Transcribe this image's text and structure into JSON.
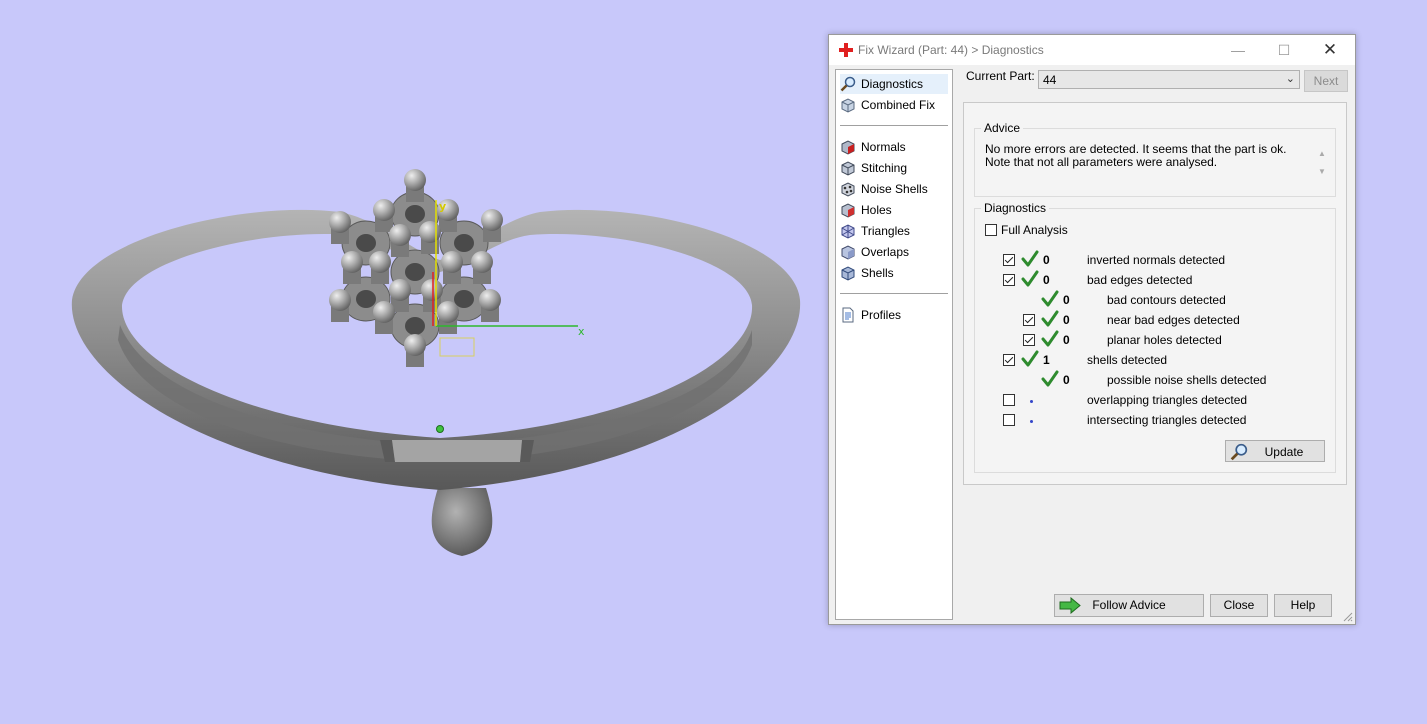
{
  "viewport": {
    "background_color": "#c8c8fa",
    "axis_x_label": "x",
    "axis_y_label": "y",
    "model_color": "#8f8f8f"
  },
  "dialog": {
    "title": "Fix Wizard (Part: 44) > Diagnostics",
    "window_controls": [
      "minimize-icon",
      "maximize-icon",
      "close-icon"
    ],
    "nav": {
      "top_items": [
        {
          "label": "Diagnostics",
          "icon": "magnifier-icon",
          "selected": true
        },
        {
          "label": "Combined Fix",
          "icon": "combined-fix-icon"
        }
      ],
      "tool_items": [
        {
          "label": "Normals",
          "icon": "normals-icon"
        },
        {
          "label": "Stitching",
          "icon": "stitching-icon"
        },
        {
          "label": "Noise Shells",
          "icon": "noise-shells-icon"
        },
        {
          "label": "Holes",
          "icon": "holes-icon"
        },
        {
          "label": "Triangles",
          "icon": "triangles-icon"
        },
        {
          "label": "Overlaps",
          "icon": "overlaps-icon"
        },
        {
          "label": "Shells",
          "icon": "shells-icon"
        }
      ],
      "bottom_items": [
        {
          "label": "Profiles",
          "icon": "profiles-icon"
        }
      ]
    },
    "current_part_label": "Current Part:",
    "current_part_value": "44",
    "next_label": "Next",
    "advice": {
      "title": "Advice",
      "text": "No more errors are detected. It seems that the part is ok. Note that not all parameters were analysed."
    },
    "diagnostics": {
      "title": "Diagnostics",
      "full_analysis_label": "Full Analysis",
      "full_analysis_checked": false,
      "rows": [
        {
          "label": "inverted normals detected",
          "checkbox": true,
          "checked": true,
          "status": "ok",
          "count": "0",
          "level": 0
        },
        {
          "label": "bad edges detected",
          "checkbox": true,
          "checked": true,
          "status": "ok",
          "count": "0",
          "level": 0
        },
        {
          "label": "bad contours detected",
          "checkbox": false,
          "checked": false,
          "status": "ok",
          "count": "0",
          "level": 1
        },
        {
          "label": "near bad edges detected",
          "checkbox": true,
          "checked": true,
          "status": "ok",
          "count": "0",
          "level": 1
        },
        {
          "label": "planar holes detected",
          "checkbox": true,
          "checked": true,
          "status": "ok",
          "count": "0",
          "level": 1
        },
        {
          "label": "shells detected",
          "checkbox": true,
          "checked": true,
          "status": "ok",
          "count": "1",
          "level": 0
        },
        {
          "label": "possible noise shells detected",
          "checkbox": false,
          "checked": false,
          "status": "ok",
          "count": "0",
          "level": 1
        },
        {
          "label": "overlapping triangles detected",
          "checkbox": true,
          "checked": false,
          "status": "not-analysed",
          "count": "",
          "level": 0
        },
        {
          "label": "intersecting triangles detected",
          "checkbox": true,
          "checked": false,
          "status": "not-analysed",
          "count": "",
          "level": 0
        }
      ],
      "update_label": "Update"
    },
    "buttons": {
      "follow_advice": "Follow Advice",
      "close": "Close",
      "help": "Help"
    },
    "colors": {
      "ok_check": "#2e8b2e",
      "not_analysed_dot": "#3346c8",
      "selection": "#e5f0fb"
    }
  }
}
